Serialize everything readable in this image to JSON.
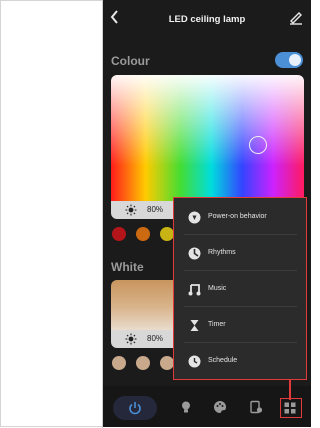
{
  "header": {
    "title": "LED ceiling lamp",
    "back_icon": "chevron-left-icon",
    "edit_icon": "pencil-icon"
  },
  "colour_section": {
    "title": "Colour",
    "toggle_on": true,
    "accent_color": "#4b8fd6",
    "brightness": "80%",
    "swatches": [
      "#b3151b",
      "#cc6a12",
      "#c8b314"
    ]
  },
  "white_section": {
    "title": "White",
    "brightness": "80%",
    "swatches": [
      "#c9a98c",
      "#c9a98c",
      "#c9a98c"
    ]
  },
  "menu": {
    "border_color": "#e23a3a",
    "items": [
      {
        "label": "Power-on behavior",
        "icon": "power-behavior-icon"
      },
      {
        "label": "Rhythms",
        "icon": "rhythms-icon"
      },
      {
        "label": "Music",
        "icon": "music-note-icon"
      },
      {
        "label": "Timer",
        "icon": "hourglass-icon"
      },
      {
        "label": "Schedule",
        "icon": "clock-icon"
      }
    ]
  },
  "tab_bar": {
    "items": [
      "power-icon",
      "bulb-icon",
      "palette-icon",
      "scene-icon",
      "grid-icon"
    ],
    "active": "grid-icon"
  }
}
